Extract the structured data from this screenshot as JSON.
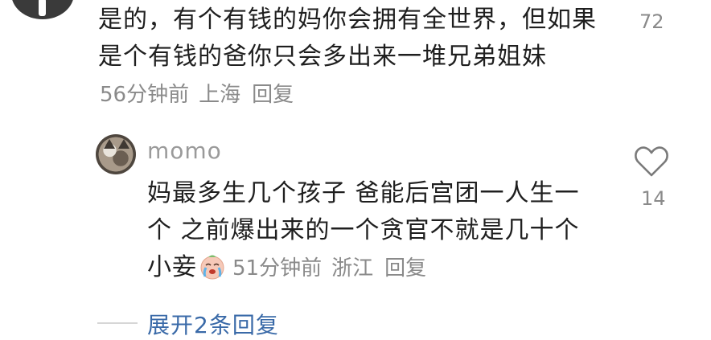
{
  "comment1": {
    "text": "是的，有个有钱的妈你会拥有全世界，但如果是个有钱的爸你只会多出来一堆兄弟姐妹",
    "time": "56分钟前",
    "location": "上海",
    "reply_label": "回复",
    "like_count": "72"
  },
  "reply1": {
    "username": "momo",
    "text": "妈最多生几个孩子 爸能后宫团一人生一个 之前爆出来的一个贪官不就是几十个小妾",
    "emoji": "crying-face",
    "time": "51分钟前",
    "location": "浙江",
    "reply_label": "回复",
    "like_count": "14"
  },
  "expand": {
    "label": "展开2条回复"
  }
}
